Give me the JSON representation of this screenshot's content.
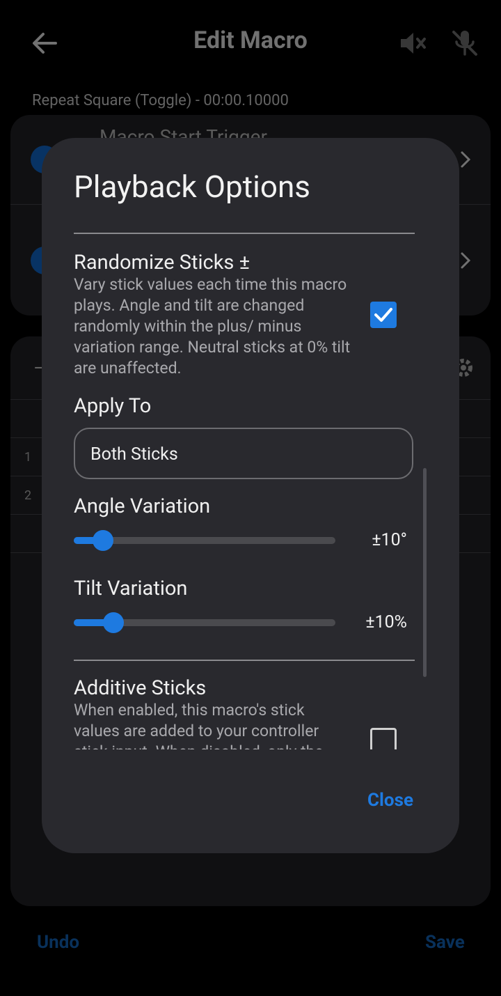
{
  "app": {
    "title": "Edit Macro",
    "macro_subtitle": "Repeat Square (Toggle) - 00:00.10000",
    "trigger_label": "Macro Start Trigger",
    "row_numbers": [
      "1",
      "2"
    ],
    "undo_label": "Undo",
    "save_label": "Save"
  },
  "dialog": {
    "title": "Playback Options",
    "randomize": {
      "title": "Randomize Sticks ±",
      "description": "Vary stick values each time this macro plays. Angle and tilt are changed randomly within the plus/ minus variation range. Neutral sticks at 0% tilt are unaffected.",
      "checked": true
    },
    "apply_to": {
      "label": "Apply To",
      "value": "Both Sticks"
    },
    "angle_variation": {
      "label": "Angle Variation",
      "value_text": "±10°",
      "fraction": 0.07
    },
    "tilt_variation": {
      "label": "Tilt Variation",
      "value_text": "±10%",
      "fraction": 0.11
    },
    "additive": {
      "title": "Additive Sticks",
      "description": "When enabled, this macro's stick values are added to your controller stick input. When disabled, only the",
      "checked": false
    },
    "close_label": "Close"
  },
  "colors": {
    "accent": "#1e7ae0",
    "dialog_bg": "#29292e",
    "background": "#000000"
  },
  "icons": {
    "back": "arrow-left-icon",
    "mute": "volume-off-icon",
    "mic": "mic-off-icon",
    "chevron": "chevron-right-icon",
    "settings": "gear-icon",
    "check": "check-icon"
  }
}
